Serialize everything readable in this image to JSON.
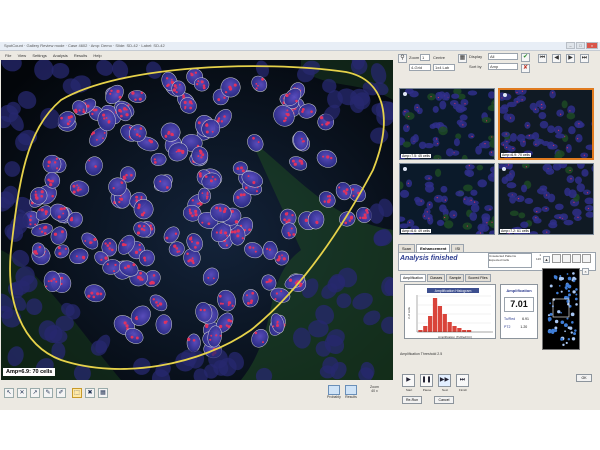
{
  "window": {
    "title": "SpotCount · Gallery Review mode · Case 4602 · Amp: Demo · Slide: SD-42 · Label: SD-42",
    "app_name": "Spot Count"
  },
  "menu": [
    "File",
    "View",
    "Settings",
    "Analysis",
    "Results",
    "Help"
  ],
  "main_image": {
    "label": "Amp=6.9: 70 cells"
  },
  "thumbnails": [
    {
      "label": "Amp=7.5: 45 cells",
      "selected": false
    },
    {
      "label": "Amp=6.9: 70 cells",
      "selected": true
    },
    {
      "label": "Amp=6.6: 49 cells",
      "selected": false
    },
    {
      "label": "Amp=7.2: 61 cells",
      "selected": false
    }
  ],
  "top_controls": {
    "zoom_label": "Zoom",
    "zoom_value": "1",
    "center_label": "Centre",
    "display_label": "Display",
    "display_value": "All",
    "sort_label": "Sort by",
    "sort_value": "Amp",
    "view_value": "4-Grid",
    "layout_value": "1x4 Lab"
  },
  "analysis": {
    "tabs": [
      "Scan",
      "Enhancement",
      "ISI"
    ],
    "active_tab": "Enhancement",
    "status": "Analysis finished",
    "list_items": [
      "Unselected Patterns",
      "Expected Cells"
    ],
    "list_counts": [
      "1",
      "126"
    ],
    "subtabs": [
      "Amplification",
      "Classes",
      "Sample",
      "Scored Files"
    ],
    "active_subtab": "Amplification",
    "histogram": {
      "title": "Amplification Histogram",
      "y_label": "# of cells",
      "x_label": "Amplification (Ts/Red/Ctr)"
    },
    "amp_title": "Amplification",
    "amp_value": "7.01",
    "ratio1_label": "To/Red",
    "ratio1_value": "6.91",
    "ratio2_label": "PT2",
    "ratio2_value": "1.20",
    "footer": "Amplification Threshold  2.5",
    "play_buttons": [
      "Start",
      "Pause",
      "Next",
      "Finish"
    ],
    "small_buttons": [
      "Re-Run",
      "Cancel",
      "OK"
    ]
  },
  "bottom_right": {
    "label1": "Probably",
    "label2": "Results",
    "zoom_text": "Zoom",
    "zoom_value": "40 x"
  },
  "chart_data": {
    "type": "bar",
    "title": "Amplification Histogram",
    "xlabel": "Amplification (Ts/Red/Ctr)",
    "ylabel": "# of cells",
    "categories": [
      "1",
      "2",
      "3",
      "4",
      "5",
      "6",
      "7",
      "8",
      "9",
      "10",
      "11",
      "12",
      "13",
      "14",
      "15"
    ],
    "values": [
      1,
      3,
      8,
      17,
      13,
      9,
      5,
      3,
      2,
      1,
      1,
      0,
      0,
      0,
      0
    ],
    "ylim": [
      0,
      18
    ],
    "grid": true
  },
  "colors": {
    "roi_outline": "#e6d24a",
    "nucleus": "#3b3fae",
    "signal": "#e0325f",
    "selected_thumb": "#e07a1e",
    "status_text": "#2b3b8f",
    "histogram_bar": "#d9433a"
  }
}
